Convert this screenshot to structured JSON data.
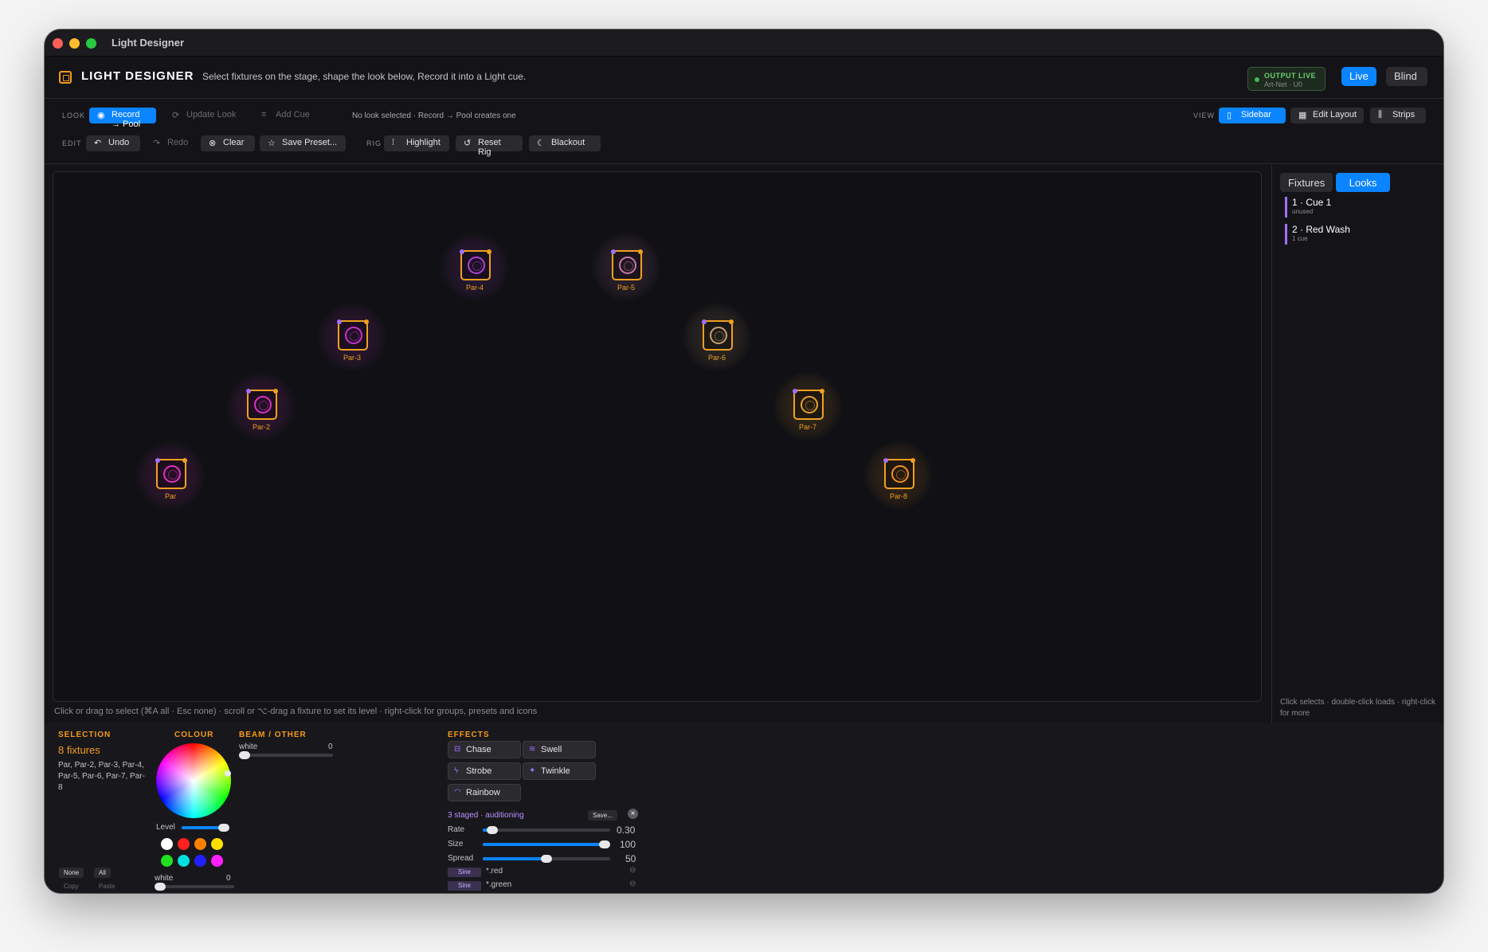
{
  "window": {
    "title": "Light Designer"
  },
  "header": {
    "title": "LIGHT DESIGNER",
    "subtitle": "Select fixtures on the stage, shape the look below, Record it into a Light cue.",
    "output_status": "OUTPUT LIVE",
    "output_detail": "Art-Net · U0",
    "modes": [
      "Live",
      "Blind"
    ]
  },
  "toolbar": {
    "look_label": "LOOK",
    "record_pool": "Record → Pool",
    "update_look": "Update Look",
    "add_cue": "Add Cue",
    "look_status": "No look selected · Record → Pool creates one",
    "view_label": "VIEW",
    "view_sidebar": "Sidebar",
    "view_edit_layout": "Edit Layout",
    "view_strips": "Strips",
    "edit_label": "EDIT",
    "undo": "Undo",
    "redo": "Redo",
    "clear": "Clear",
    "save_preset": "Save Preset...",
    "rig_label": "RIG",
    "highlight": "Highlight",
    "reset_rig": "Reset Rig",
    "blackout": "Blackout"
  },
  "stage": {
    "fixtures": [
      {
        "name": "Par",
        "color": "#e030c0"
      },
      {
        "name": "Par-2",
        "color": "#d830c8"
      },
      {
        "name": "Par-3",
        "color": "#c830d0"
      },
      {
        "name": "Par-4",
        "color": "#b040d8"
      },
      {
        "name": "Par-5",
        "color": "#c878b0"
      },
      {
        "name": "Par-6",
        "color": "#c8a070"
      },
      {
        "name": "Par-7",
        "color": "#e8a030"
      },
      {
        "name": "Par-8",
        "color": "#f09020"
      }
    ],
    "hint": "Click or drag to select (⌘A all · Esc none) · scroll or ⌥-drag a fixture to set its level · right-click for groups, presets and icons"
  },
  "sidebar": {
    "tabs": [
      "Fixtures",
      "Looks"
    ],
    "looks": [
      {
        "title": "1 · Cue 1",
        "sub": "unused"
      },
      {
        "title": "2 · Red Wash",
        "sub": "1 cue"
      }
    ],
    "hint": "Click selects · double-click loads · right-click for more"
  },
  "selection": {
    "heading": "SELECTION",
    "count": "8 fixtures",
    "list": "Par, Par-2, Par-3, Par-4, Par-5, Par-6, Par-7, Par-8",
    "none": "None",
    "all": "All",
    "copy": "Copy",
    "paste": "Paste"
  },
  "colour": {
    "heading": "COLOUR",
    "level_label": "Level",
    "level": 0.95,
    "swatches": [
      "#ffffff",
      "#ff2020",
      "#ff8000",
      "#ffe000",
      "#20e020",
      "#00e0e0",
      "#2020ff",
      "#ff20ff"
    ],
    "white_label": "white",
    "white_value": "0"
  },
  "beam": {
    "heading": "BEAM / OTHER",
    "white_label": "white",
    "white_value": "0"
  },
  "effects": {
    "heading": "EFFECTS",
    "buttons": [
      {
        "label": "Chase",
        "icon": "chase-icon"
      },
      {
        "label": "Swell",
        "icon": "wave-icon"
      },
      {
        "label": "Strobe",
        "icon": "bolt-icon"
      },
      {
        "label": "Twinkle",
        "icon": "sparkle-icon"
      },
      {
        "label": "Rainbow",
        "icon": "rainbow-icon"
      }
    ],
    "staged": "3 staged · auditioning",
    "save": "Save...",
    "rate_label": "Rate",
    "rate_value": "0.30",
    "size_label": "Size",
    "size_value": "100",
    "spread_label": "Spread",
    "spread_value": "50",
    "layers": [
      {
        "wave": "Sine",
        "target": "*.red"
      },
      {
        "wave": "Sine",
        "target": "*.green"
      }
    ]
  }
}
